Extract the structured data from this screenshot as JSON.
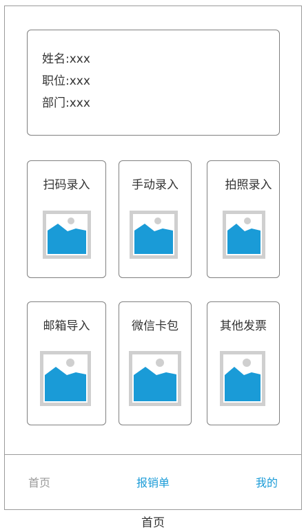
{
  "profile": {
    "name": "姓名:xxx",
    "position": "职位:xxx",
    "department": "部门:xxx"
  },
  "tiles": [
    {
      "label": "扫码录入",
      "icon": "image-placeholder-icon"
    },
    {
      "label": "手动录入",
      "icon": "image-placeholder-icon"
    },
    {
      "label": "拍照录入",
      "icon": "image-placeholder-icon"
    },
    {
      "label": "邮箱导入",
      "icon": "image-placeholder-icon"
    },
    {
      "label": "微信卡包",
      "icon": "image-placeholder-icon"
    },
    {
      "label": "其他发票",
      "icon": "image-placeholder-icon"
    }
  ],
  "tabbar": {
    "home": "首页",
    "reimburse": "报销单",
    "mine": "我的"
  },
  "colors": {
    "accent": "#1a9bd7",
    "tab_inactive": "#999999",
    "placeholder_frame": "#cfcfcf",
    "placeholder_fill": "#1a9bd7"
  },
  "caption": "首页"
}
